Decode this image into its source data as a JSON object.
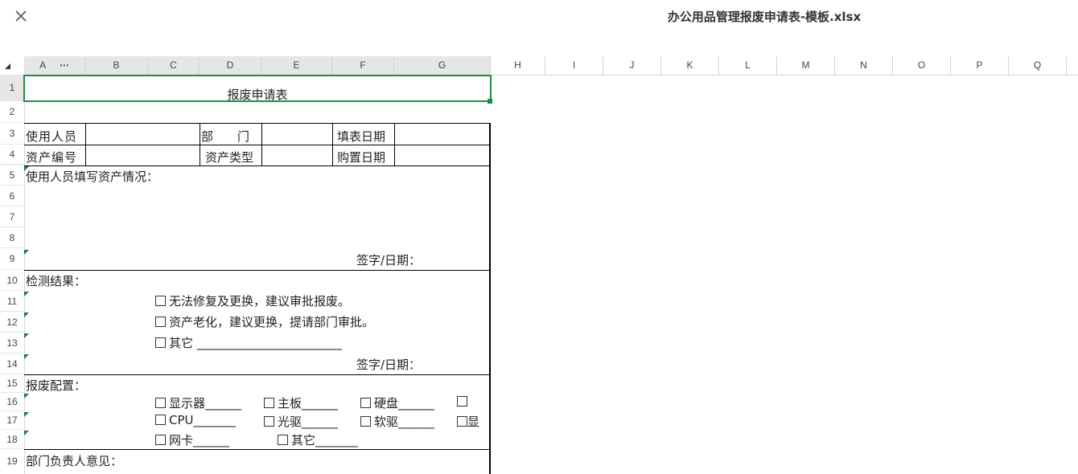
{
  "window": {
    "title": "办公用品管理报废申请表-模板.xlsx"
  },
  "columns": [
    "A",
    "B",
    "C",
    "D",
    "E",
    "F",
    "G",
    "H",
    "I",
    "J",
    "K",
    "L",
    "M",
    "N",
    "O",
    "P",
    "Q"
  ],
  "column_more": "⋯",
  "rows": [
    "1",
    "2",
    "3",
    "4",
    "5",
    "6",
    "7",
    "8",
    "9",
    "10",
    "11",
    "12",
    "13",
    "14",
    "15",
    "16",
    "17",
    "18",
    "19"
  ],
  "form": {
    "title": "报废申请表",
    "r3": {
      "user": "使用人员",
      "dept": "部　　门",
      "fill_date": "填表日期"
    },
    "r4": {
      "asset_no": "资产编号",
      "asset_type": "资产类型",
      "purchase_date": "购置日期"
    },
    "r5": "使用人员填写资产情况：",
    "r9_sign": "签字/日期：",
    "r10": "检测结果：",
    "r11": "无法修复及更换，建议审批报废。",
    "r12": "资产老化，建议更换，提请部门审批。",
    "r13": "其它 ________________________",
    "r14_sign": "签字/日期：",
    "r15": "报废配置：",
    "r16": [
      "显示器______",
      "主板______",
      "硬盘______",
      ""
    ],
    "r17": [
      "CPU_______",
      "光驱______",
      "软驱______",
      "显"
    ],
    "r18": [
      "网卡______",
      "其它_______"
    ],
    "r19": "部门负责人意见："
  }
}
